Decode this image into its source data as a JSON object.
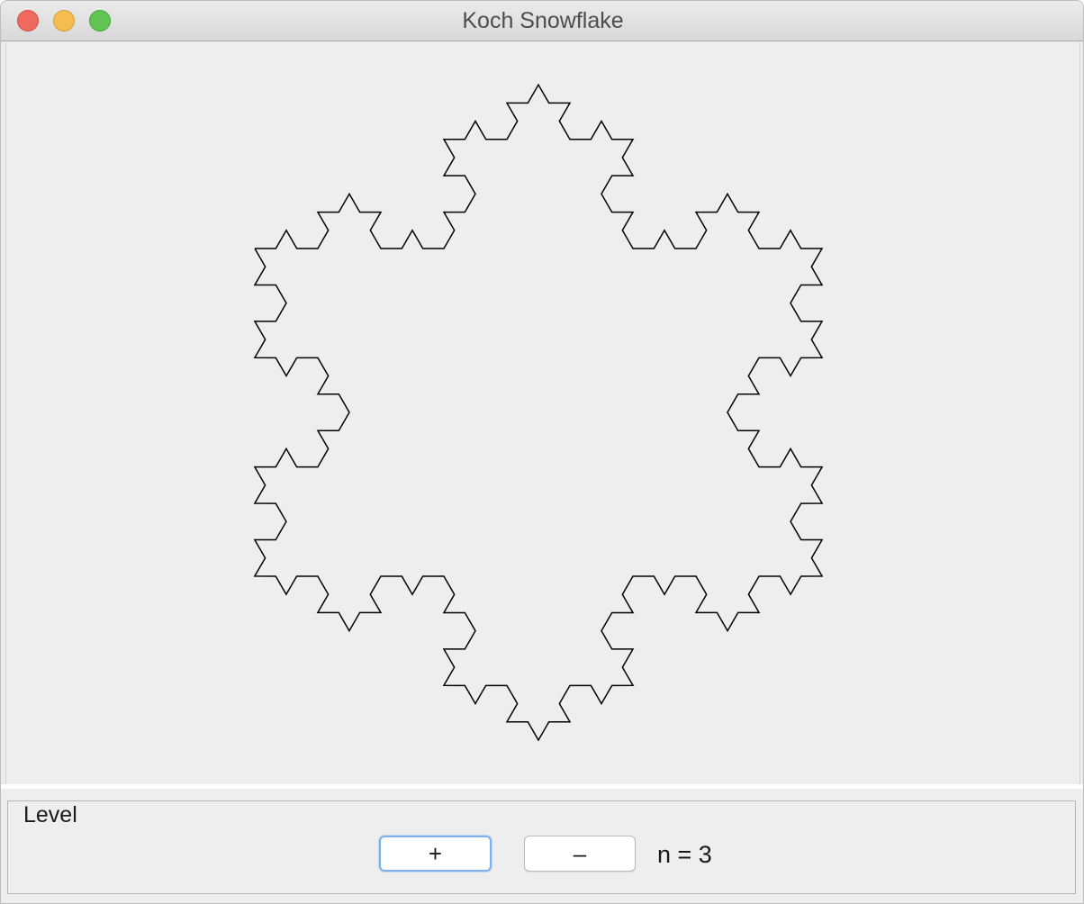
{
  "window": {
    "title": "Koch Snowflake"
  },
  "controls": {
    "group_label": "Level",
    "increase_label": "+",
    "decrease_label": "–",
    "level_text": "n = 3"
  },
  "snowflake": {
    "level": 3,
    "stroke_color": "#000000",
    "background_color": "#eeeeee"
  },
  "colors": {
    "close": "#ee6a5f",
    "minimize": "#f5bd4f",
    "zoom": "#61c554",
    "focus_ring": "#7fb0ea"
  }
}
